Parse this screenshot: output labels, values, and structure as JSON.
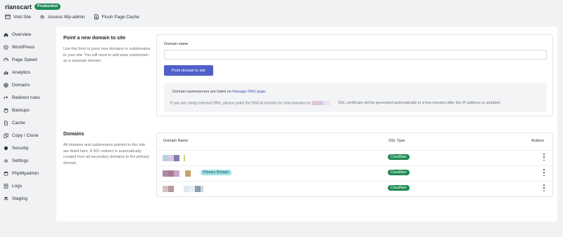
{
  "header": {
    "site_name": "rianscart",
    "env_badge": "Production",
    "actions": [
      {
        "label": "Visit Site",
        "icon": "window-icon"
      },
      {
        "label": "Access Wp-admin",
        "icon": "gear-icon"
      },
      {
        "label": "Flush Page Cache",
        "icon": "document-icon"
      }
    ]
  },
  "sidebar": {
    "items": [
      {
        "label": "Overview",
        "icon": "home-icon"
      },
      {
        "label": "WordPress",
        "icon": "wordpress-icon"
      },
      {
        "label": "Page Speed",
        "icon": "speedometer-icon"
      },
      {
        "label": "Analytics",
        "icon": "bar-chart-icon"
      },
      {
        "label": "Domains",
        "icon": "globe-icon"
      },
      {
        "label": "Redirect rules",
        "icon": "redirect-icon"
      },
      {
        "label": "Backups",
        "icon": "database-icon"
      },
      {
        "label": "Cache",
        "icon": "document-icon"
      },
      {
        "label": "Copy / Clone",
        "icon": "copy-icon"
      },
      {
        "label": "Security",
        "icon": "shield-icon"
      },
      {
        "label": "Settings",
        "icon": "gear-icon"
      },
      {
        "label": "PhpMyadmin",
        "icon": "database-icon"
      },
      {
        "label": "Logs",
        "icon": "list-icon"
      },
      {
        "label": "Staging",
        "icon": "layers-icon"
      }
    ]
  },
  "point_domain": {
    "title": "Point a new domain to site",
    "description": "Use this form to point new domains or subdomains to your site. You will need to add www subdomain as a separate domain.",
    "field_label": "Domain name",
    "field_value": "",
    "button_label": "Point domain to site",
    "dns_text_prefix": "Domain nameservers are listed on",
    "dns_link": "Manage DNS page.",
    "dns_note_before": "If you are using external DNS, please point the DNS A records for new domains to",
    "dns_note_after": "SSL certificate will be generated automatically in a few minutes after the IP address is updated."
  },
  "domains": {
    "title": "Domains",
    "description": "All domains and subdomains pointed to this site are listed here. A 301 redirect is automatically created from all secondary domains to the primary domain.",
    "columns": {
      "name": "Domain Name",
      "ssl": "SSL Type",
      "actions": "Actions"
    },
    "rows": [
      {
        "ssl": "Cloudflare",
        "primary_tag": ""
      },
      {
        "ssl": "Cloudflare",
        "primary_tag": "Primary Domain"
      },
      {
        "ssl": "Cloudflare",
        "primary_tag": ""
      }
    ]
  },
  "colors": {
    "accent": "#5060c8",
    "success": "#1f8a53",
    "primary_tag_bg": "#9fe3e6"
  }
}
